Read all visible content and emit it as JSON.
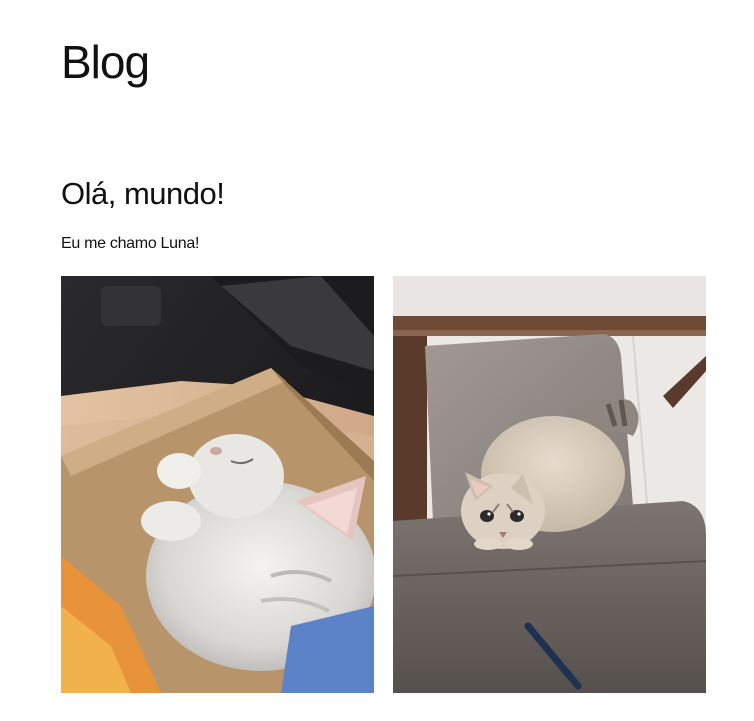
{
  "site": {
    "title": "Blog"
  },
  "post": {
    "title": "Olá, mundo!",
    "text": "Eu me chamo Luna!"
  },
  "gallery": {
    "images": [
      {
        "subject": "kitten-in-cardboard-box"
      },
      {
        "subject": "cat-on-chair"
      }
    ]
  }
}
